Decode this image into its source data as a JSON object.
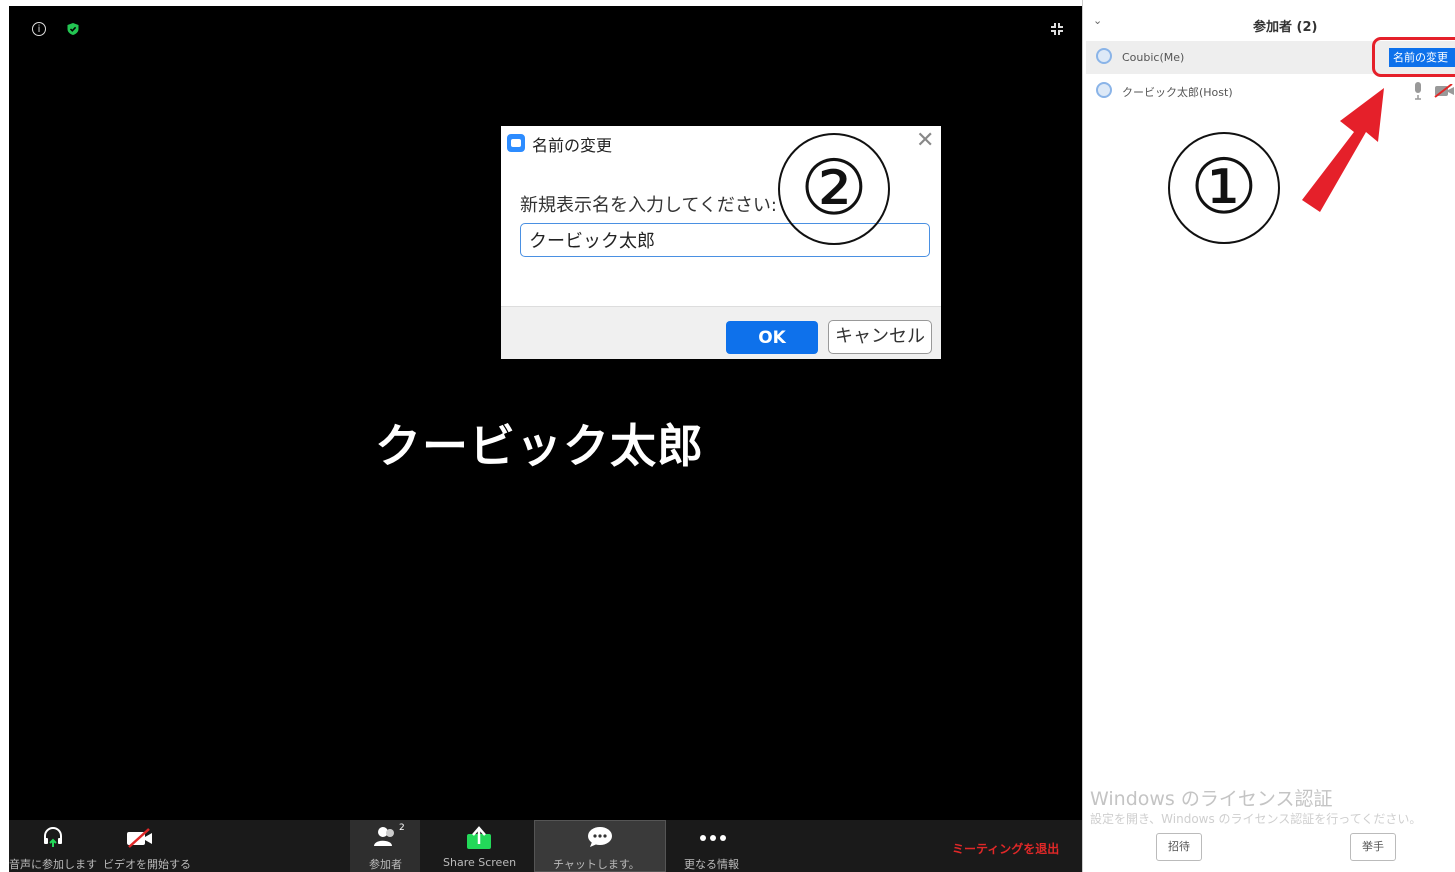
{
  "meeting": {
    "video_display_name": "クービック太郎",
    "info_icon": "info-icon",
    "security_icon": "shield-icon",
    "fullscreen_icon": "fullscreen-icon"
  },
  "dialog": {
    "title": "名前の変更",
    "close_glyph": "✕",
    "prompt": "新規表示名を入力してください:",
    "input_value": "クービック太郎",
    "ok_label": "OK",
    "cancel_label": "キャンセル"
  },
  "annotations": {
    "step1": "①",
    "step2": "②",
    "highlight_color": "#e5202a",
    "arrow_color": "#e5202a"
  },
  "toolbar": {
    "audio_label": "音声に参加します",
    "video_label": "ビデオを開始する",
    "participants_label": "参加者",
    "participants_count": "2",
    "share_label": "Share Screen",
    "chat_label": "チャットします。",
    "more_label": "更なる情報",
    "leave_label": "ミーティングを退出"
  },
  "panel": {
    "title": "参加者 (2)",
    "collapse_glyph": "⌄",
    "participants": [
      {
        "name": "Coubic(Me)",
        "action_label": "名前の変更"
      },
      {
        "name": "クービック太郎(Host)"
      }
    ],
    "invite_label": "招待",
    "raise_hand_label": "挙手",
    "watermark_title": "Windows のライセンス認証",
    "watermark_sub": "設定を開き、Windows のライセンス認証を行ってください。"
  },
  "colors": {
    "accent": "#0e71eb",
    "video_bg": "#000000",
    "leave": "#e02828",
    "share_green": "#23d959"
  }
}
